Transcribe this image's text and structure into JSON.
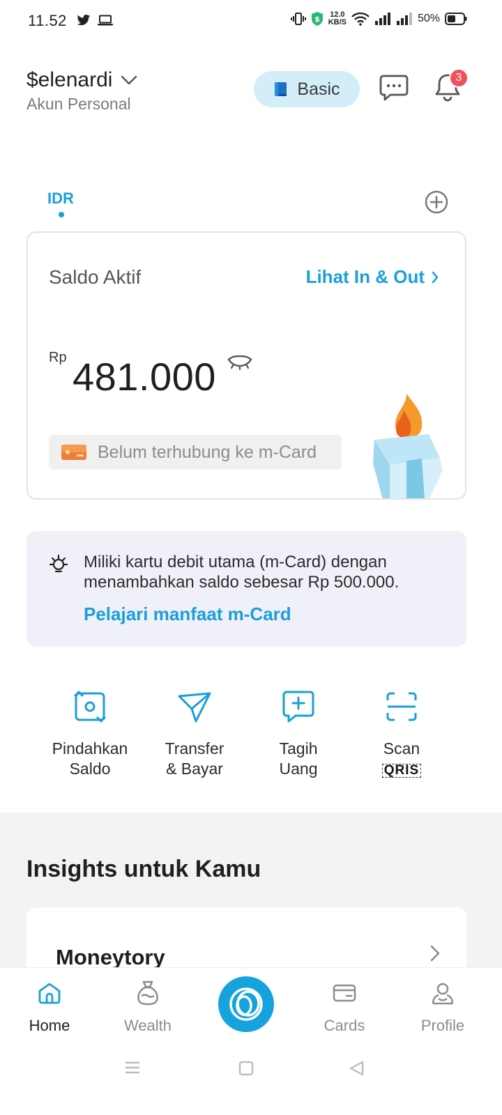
{
  "status_bar": {
    "time": "11.52",
    "net_speed_value": "12.0",
    "net_speed_unit": "KB/S",
    "battery": "50%"
  },
  "header": {
    "account_name": "$elenardi",
    "account_type": "Akun Personal",
    "tier_label": "Basic",
    "notification_count": "3"
  },
  "currency_tabs": {
    "active": "IDR"
  },
  "balance_card": {
    "label": "Saldo Aktif",
    "link_label": "Lihat In & Out",
    "currency": "Rp",
    "amount": "481.000",
    "mcard_status": "Belum terhubung ke m-Card"
  },
  "info_box": {
    "text": "Miliki kartu debit utama (m-Card) dengan menambahkan saldo sebesar Rp 500.000.",
    "link": "Pelajari manfaat m-Card"
  },
  "actions": [
    {
      "line1": "Pindahkan",
      "line2": "Saldo",
      "icon": "move-balance-icon"
    },
    {
      "line1": "Transfer",
      "line2": "& Bayar",
      "icon": "send-icon"
    },
    {
      "line1": "Tagih",
      "line2": "Uang",
      "icon": "request-money-icon"
    },
    {
      "line1": "Scan",
      "line2": "QRIS",
      "icon": "scan-icon"
    }
  ],
  "insights": {
    "title": "Insights untuk Kamu",
    "card_title": "Moneytory"
  },
  "bottom_nav": [
    {
      "label": "Home",
      "icon": "home-icon",
      "active": true
    },
    {
      "label": "Wealth",
      "icon": "moneybag-icon",
      "active": false
    },
    {
      "label": "Cards",
      "icon": "card-icon",
      "active": false
    },
    {
      "label": "Profile",
      "icon": "profile-icon",
      "active": false
    }
  ],
  "colors": {
    "accent": "#1a9fd8",
    "badge": "#f0505a",
    "tier_bg": "#d3eef9",
    "info_bg": "#f0f0f9"
  }
}
